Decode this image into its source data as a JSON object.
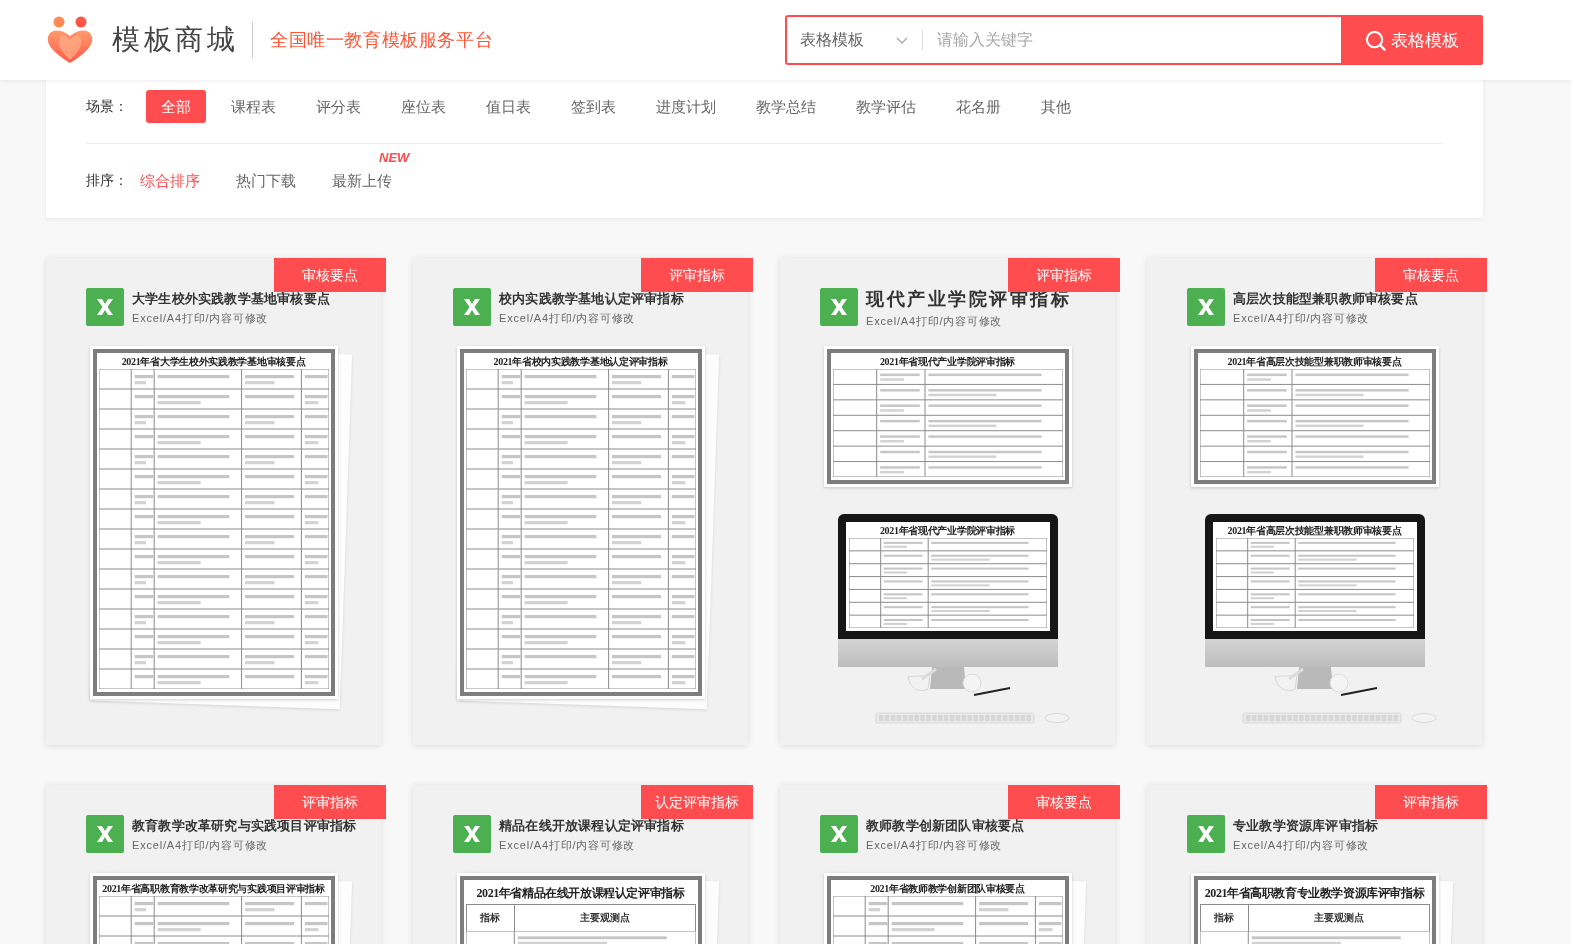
{
  "header": {
    "brand": "模板商城",
    "slogan": "全国唯一教育模板服务平台",
    "search": {
      "category": "表格模板",
      "placeholder": "请输入关键字",
      "button": "表格模板"
    }
  },
  "filters": {
    "scene_label": "场景：",
    "scenes": [
      {
        "label": "全部",
        "selected": true
      },
      {
        "label": "课程表",
        "selected": false
      },
      {
        "label": "评分表",
        "selected": false
      },
      {
        "label": "座位表",
        "selected": false
      },
      {
        "label": "值日表",
        "selected": false
      },
      {
        "label": "签到表",
        "selected": false
      },
      {
        "label": "进度计划",
        "selected": false
      },
      {
        "label": "教学总结",
        "selected": false
      },
      {
        "label": "教学评估",
        "selected": false
      },
      {
        "label": "花名册",
        "selected": false
      },
      {
        "label": "其他",
        "selected": false
      }
    ],
    "sort_label": "排序：",
    "sorts": [
      {
        "label": "综合排序",
        "selected": true
      },
      {
        "label": "热门下载",
        "selected": false
      },
      {
        "label": "最新上传",
        "selected": false,
        "badge": "NEW"
      }
    ]
  },
  "cards": [
    {
      "tag": "审核要点",
      "title": "大学生校外实践教学基地审核要点",
      "title_large": false,
      "subtitle": "Excel/A4打印/内容可修改",
      "preview": {
        "kind": "sheet",
        "title": "2021年省大学生校外实践教学基地审核要点",
        "title_large": false
      }
    },
    {
      "tag": "评审指标",
      "title": "校内实践教学基地认定评审指标",
      "title_large": false,
      "subtitle": "Excel/A4打印/内容可修改",
      "preview": {
        "kind": "sheet",
        "title": "2021年省校内实践教学基地认定评审指标",
        "title_large": false
      }
    },
    {
      "tag": "评审指标",
      "title": "现代产业学院评审指标",
      "title_large": true,
      "subtitle": "Excel/A4打印/内容可修改",
      "preview": {
        "kind": "monitor",
        "title": "2021年省现代产业学院评审指标",
        "screen_title": "2021年省现代产业学院评审指标"
      }
    },
    {
      "tag": "审核要点",
      "title": "高层次技能型兼职教师审核要点",
      "title_large": false,
      "subtitle": "Excel/A4打印/内容可修改",
      "preview": {
        "kind": "monitor",
        "title": "2021年省高层次技能型兼职教师审核要点",
        "screen_title": "2021年省高层次技能型兼职教师审核要点"
      }
    },
    {
      "tag": "评审指标",
      "title": "教育教学改革研究与实践项目评审指标",
      "title_large": false,
      "subtitle": "Excel/A4打印/内容可修改",
      "preview": {
        "kind": "sheet",
        "title": "2021年省高职教育教学改革研究与实践项目评审指标",
        "title_large": false
      }
    },
    {
      "tag": "认定评审指标",
      "title": "精品在线开放课程认定评审指标",
      "title_large": false,
      "subtitle": "Excel/A4打印/内容可修改",
      "preview": {
        "kind": "sheet",
        "title": "2021年省精品在线开放课程认定评审指标",
        "title_large": true,
        "columns": [
          "指标",
          "主要观测点"
        ]
      }
    },
    {
      "tag": "审核要点",
      "title": "教师教学创新团队审核要点",
      "title_large": false,
      "subtitle": "Excel/A4打印/内容可修改",
      "preview": {
        "kind": "sheet",
        "title": "2021年省教师教学创新团队审核要点",
        "title_large": false
      }
    },
    {
      "tag": "评审指标",
      "title": "专业教学资源库评审指标",
      "title_large": false,
      "subtitle": "Excel/A4打印/内容可修改",
      "preview": {
        "kind": "sheet",
        "title": "2021年省高职教育专业教学资源库评审指标",
        "title_large": true,
        "columns": [
          "指标",
          "主要观测点"
        ]
      }
    }
  ]
}
